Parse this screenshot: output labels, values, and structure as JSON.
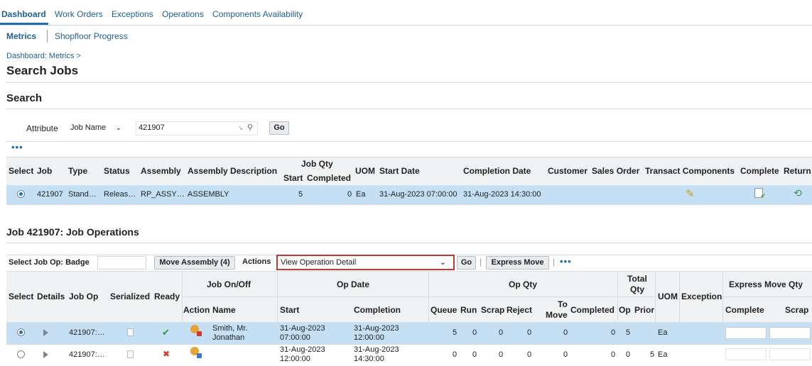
{
  "tabs": [
    "Dashboard",
    "Work Orders",
    "Exceptions",
    "Operations",
    "Components Availability"
  ],
  "subnav": {
    "metrics": "Metrics",
    "shopfloor": "Shopfloor Progress"
  },
  "breadcrumb": "Dashboard: Metrics  >",
  "page_title": "Search Jobs",
  "search": {
    "section_title": "Search",
    "attribute_label": "Attribute",
    "attribute_value": "Job Name",
    "search_value": "421907",
    "go": "Go"
  },
  "more_actions": "•••",
  "jobs_table": {
    "headers": {
      "select": "Select",
      "job": "Job",
      "type": "Type",
      "status": "Status",
      "assembly": "Assembly",
      "assembly_description": "Assembly Description",
      "job_qty": "Job Qty",
      "start": "Start",
      "completed": "Completed",
      "uom": "UOM",
      "start_date": "Start Date",
      "completion_date": "Completion Date",
      "customer": "Customer",
      "sales_order": "Sales Order",
      "transact_components": "Transact Components",
      "complete": "Complete",
      "return": "Return"
    },
    "rows": [
      {
        "job": "421907",
        "type": "Stand…",
        "status": "Releas…",
        "assembly": "RP_ASSY…",
        "assembly_description": "ASSEMBLY",
        "start": "5",
        "completed": "0",
        "uom": "Ea",
        "start_date": "31-Aug-2023 07:00:00",
        "completion_date": "31-Aug-2023 14:30:00",
        "customer": "",
        "sales_order": ""
      }
    ]
  },
  "job_ops": {
    "section_title": "Job 421907: Job Operations",
    "select_job_op_label": "Select Job Op: Badge",
    "move_assembly_btn": "Move Assembly (4)",
    "actions_label": "Actions",
    "actions_value": "View Operation Detail",
    "go": "Go",
    "express_move_btn": "Express Move",
    "headers": {
      "select": "Select",
      "details": "Details",
      "job_op": "Job Op",
      "serialized": "Serialized",
      "ready": "Ready",
      "job_on_off": "Job On/Off",
      "action": "Action",
      "name": "Name",
      "op_date": "Op Date",
      "start": "Start",
      "completion": "Completion",
      "op_qty": "Op Qty",
      "queue": "Queue",
      "run": "Run",
      "scrap": "Scrap",
      "reject": "Reject",
      "to_move_1": "To",
      "to_move_2": "Move",
      "completed": "Completed",
      "total_qty_1": "Total",
      "total_qty_2": "Qty",
      "op": "Op",
      "prior": "Prior",
      "uom": "UOM",
      "exception": "Exception",
      "express_move_qty": "Express Move Qty",
      "em_complete": "Complete",
      "em_scrap": "Scrap"
    },
    "rows": [
      {
        "job_op": "421907:…",
        "name_1": "Smith, Mr.",
        "name_2": "Jonathan",
        "start_1": "31-Aug-2023",
        "start_2": "07:00:00",
        "completion_1": "31-Aug-2023",
        "completion_2": "12:00:00",
        "queue": "5",
        "run": "0",
        "scrap": "0",
        "reject": "0",
        "to_move": "0",
        "completed": "0",
        "op": "5",
        "prior": "",
        "uom": "Ea",
        "ready": "✔"
      },
      {
        "job_op": "421907:…",
        "name_1": "",
        "name_2": "",
        "start_1": "31-Aug-2023",
        "start_2": "12:00:00",
        "completion_1": "31-Aug-2023",
        "completion_2": "14:30:00",
        "queue": "0",
        "run": "0",
        "scrap": "0",
        "reject": "0",
        "to_move": "0",
        "completed": "0",
        "op": "0",
        "prior": "5",
        "uom": "Ea",
        "ready": "✖"
      }
    ]
  },
  "colors": {
    "link": "#1f5f94",
    "selected_row": "#c5dff4",
    "header_bg": "#f0f2f4",
    "ready_ok": "#2c9a3a",
    "ready_no": "#d33a2c",
    "accent": "#1f6fb0"
  }
}
